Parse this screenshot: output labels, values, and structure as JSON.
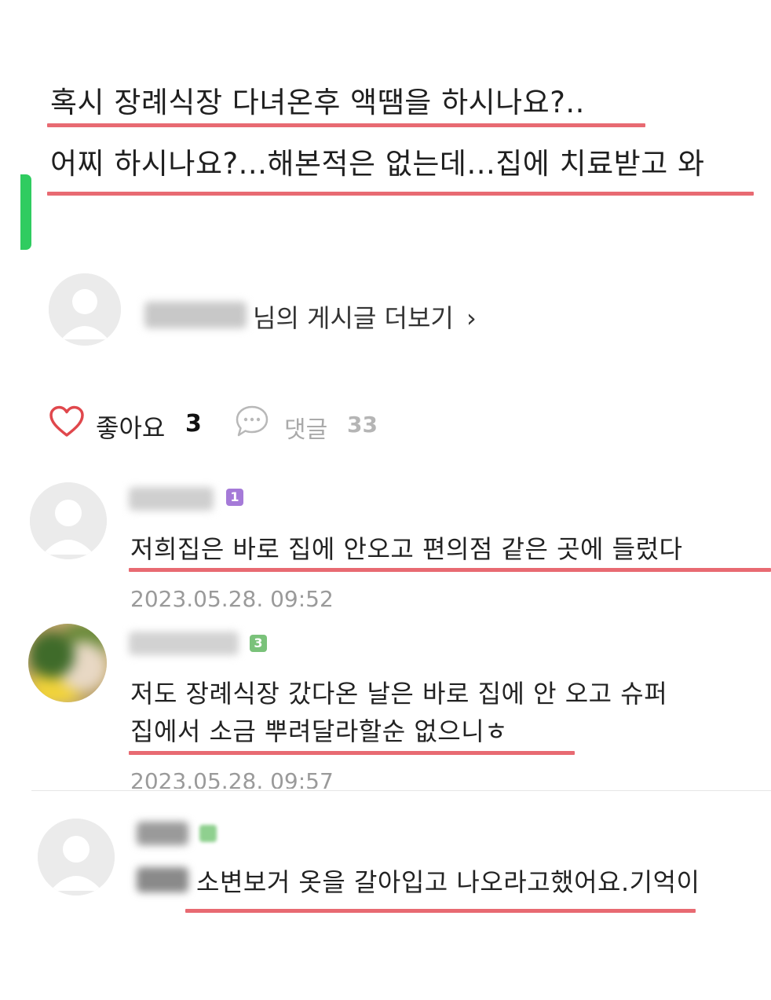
{
  "post": {
    "line1": "혹시 장례식장 다녀온후 액땜을 하시나요?..",
    "line2": "어찌 하시나요?...해본적은 없는데...집에 치료받고 와"
  },
  "author": {
    "more_posts_label": "님의 게시글 더보기",
    "chevron": "›"
  },
  "actions": {
    "like_label": "좋아요",
    "like_count": "3",
    "comment_label": "댓글",
    "comment_count": "33"
  },
  "comments": [
    {
      "level": "1",
      "badge_color": "#a57ad8",
      "text": "저희집은 바로 집에 안오고 편의점 같은 곳에 들렀다",
      "date": "2023.05.28. 09:52"
    },
    {
      "level": "3",
      "badge_color": "#7ac27a",
      "text_line1": "저도 장례식장 갔다온 날은 바로 집에 안 오고 슈퍼",
      "text_line2": "집에서 소금 뿌려달라할순 없으니ㅎ",
      "date": "2023.05.28. 09:57"
    },
    {
      "badge_color": "#8fd08f",
      "text": "소변보거 옷을 갈아입고 나오라고했어요.기억이"
    }
  ],
  "colors": {
    "underline": "#e86a72",
    "accent_green": "#2fcc60",
    "heart": "#e0474c"
  },
  "icons": [
    "heart-icon",
    "speech-bubble-icon",
    "chevron-right-icon",
    "default-avatar-icon"
  ]
}
